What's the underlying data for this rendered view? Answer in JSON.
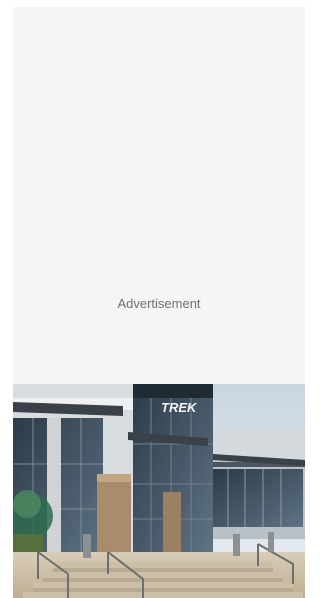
{
  "ad": {
    "label": "Advertisement"
  },
  "article_image": {
    "alt": "Trek headquarters building exterior",
    "sign_text": "TREK"
  }
}
